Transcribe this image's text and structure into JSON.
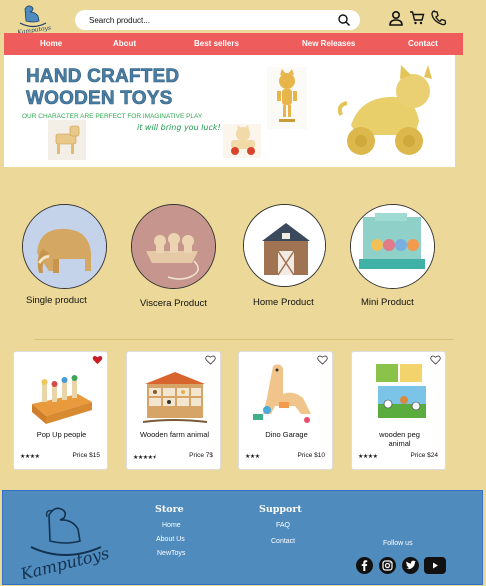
{
  "header": {
    "logo_text": "Kamputoys",
    "search_placeholder": "Search product..."
  },
  "nav": {
    "items": [
      "Home",
      "About",
      "Best sellers",
      "New Releases",
      "Contact"
    ]
  },
  "hero": {
    "title_line1": "HAND CRAFTED",
    "title_line2": "WOODEN TOYS",
    "subtitle": "OUR CHARACTER ARE PERFECT FOR IMAGINATIVE PLAY",
    "tagline": "it will bring you luck!"
  },
  "categories": [
    {
      "label": "Single product",
      "icon": "wooden-mammoth"
    },
    {
      "label": "Viscera Product",
      "icon": "wooden-ducks"
    },
    {
      "label": "Home Product",
      "icon": "wooden-barn"
    },
    {
      "label": "Mini Product",
      "icon": "peg-people-set"
    }
  ],
  "products": [
    {
      "name": "Pop Up people",
      "stars": "★★★★",
      "price": "Price $15",
      "favorited": true
    },
    {
      "name": "Wooden farm animal",
      "stars": "★★★★⯨",
      "price": "Price 7$",
      "favorited": false
    },
    {
      "name": "Dino Garage",
      "stars": "★★★",
      "price": "Price  $10",
      "favorited": false
    },
    {
      "name": "wooden peg animal",
      "stars": "★★★★",
      "price": "Price  $24",
      "favorited": false
    }
  ],
  "footer": {
    "logo_text": "Kamputoys",
    "store_heading": "Store",
    "store_links": [
      "Home",
      "About Us",
      "NewToys"
    ],
    "support_heading": "Support",
    "support_links": [
      "FAQ",
      "Contact"
    ],
    "follow_label": "Follow us",
    "social": [
      "facebook-icon",
      "instagram-icon",
      "twitter-icon",
      "youtube-icon"
    ]
  },
  "colors": {
    "background": "#ecd899",
    "nav": "#ee5c5b",
    "footer": "#4f8bbd",
    "hero_title": "#4a7fa5",
    "hero_green": "#2fa84f"
  }
}
